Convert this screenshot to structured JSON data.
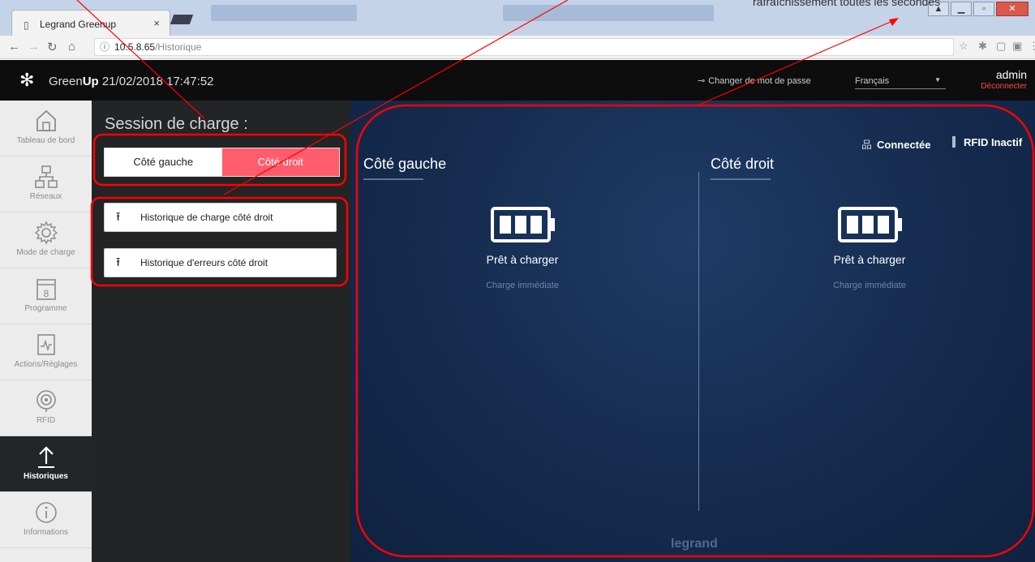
{
  "browser": {
    "tab_title": "Legrand Greenup",
    "tab_close": "×",
    "url_host": "10.5.8.65",
    "url_path": "/Historique"
  },
  "header": {
    "brand_prefix": "Green",
    "brand_bold": "Up",
    "datetime": "21/02/2018 17:47:52",
    "change_password": "Changer de mot de passe",
    "language": "Français",
    "user": "admin",
    "logout": "Déconnecter"
  },
  "sidebar": {
    "items": [
      {
        "label": "Tableau de bord",
        "icon": "home-icon"
      },
      {
        "label": "Réseaux",
        "icon": "network-icon"
      },
      {
        "label": "Mode de charge",
        "icon": "gear-icon"
      },
      {
        "label": "Programme",
        "icon": "calendar-icon",
        "icon_text": "8"
      },
      {
        "label": "Actions/Réglages",
        "icon": "activity-icon"
      },
      {
        "label": "RFID",
        "icon": "rfid-icon"
      },
      {
        "label": "Historiques",
        "icon": "upload-arrow-icon",
        "active": true
      },
      {
        "label": "Informations",
        "icon": "info-icon"
      }
    ]
  },
  "session": {
    "title": "Session de charge :",
    "left_label": "Côté gauche",
    "right_label": "Côté droit",
    "selected": "right",
    "history_charge": "Historique de charge côté droit",
    "history_errors": "Historique d'erreurs côté droit"
  },
  "status": {
    "connection": "Connectée",
    "rfid": "RFID Inactif"
  },
  "sides": [
    {
      "title": "Côté gauche",
      "state": "Prêt à charger",
      "mode": "Charge immédiate"
    },
    {
      "title": "Côté droit",
      "state": "Prêt à charger",
      "mode": "Charge immédiate"
    }
  ],
  "footer": {
    "logo": "legrand"
  },
  "annotation": {
    "text": "rafraîchissement toutes les secondes",
    "color": "#ff0000"
  },
  "colors": {
    "accent": "#ff5c6d",
    "main_bg": "#152b4e",
    "panel_bg": "#222426"
  }
}
